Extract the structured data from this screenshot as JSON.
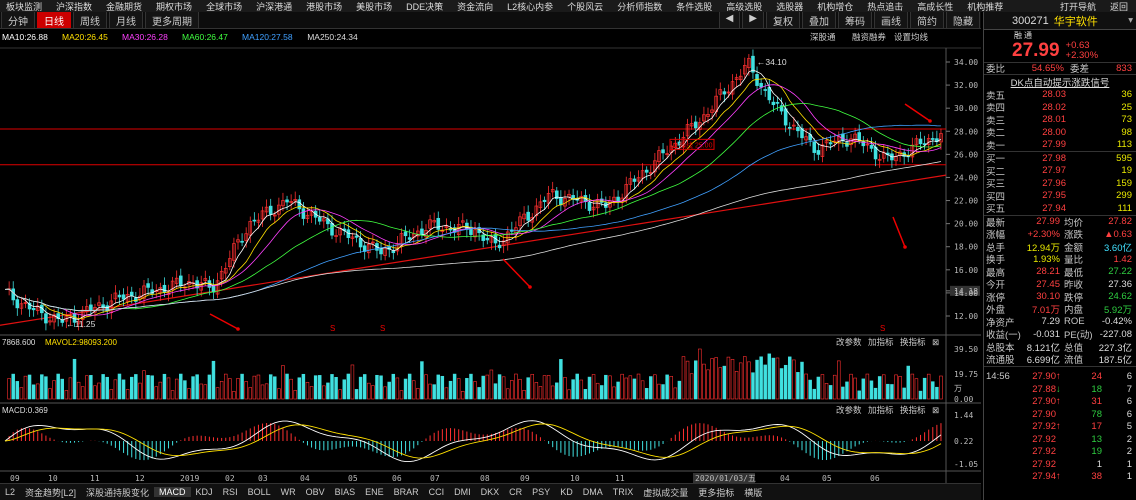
{
  "top_menu": [
    "板块监测",
    "沪深指数",
    "金融期货",
    "期权市场",
    "全球市场",
    "沪深港通",
    "港股市场",
    "美股市场",
    "DDE决策",
    "资金流向",
    "L2核心内参",
    "个股风云",
    "分析师指数",
    "条件选股",
    "高级选股",
    "选股器",
    "机构增仓",
    "热点追击",
    "高成长性",
    "机构推荐"
  ],
  "top_menu_right": [
    "打开导航",
    "返回"
  ],
  "toolbar": {
    "left": [
      "分钟",
      "日线",
      "周线",
      "月线",
      "更多周期"
    ],
    "active": "日线",
    "right": [
      "复权",
      "叠加",
      "筹码",
      "画线",
      "简约",
      "隐藏"
    ],
    "sub": [
      "深股通",
      "融资融券",
      "设置均线"
    ]
  },
  "ma_legend": [
    {
      "label": "MA10:26.88",
      "color": "#ffffff"
    },
    {
      "label": "MA20:26.45",
      "color": "#ffe000"
    },
    {
      "label": "MA30:26.28",
      "color": "#ff40ff"
    },
    {
      "label": "MA60:26.47",
      "color": "#40ff40"
    },
    {
      "label": "MA120:27.58",
      "color": "#40a0ff"
    },
    {
      "label": "MA250:24.34",
      "color": "#dddddd"
    }
  ],
  "price_axis": [
    "34.00",
    "32.00",
    "30.00",
    "28.00",
    "26.00",
    "24.00",
    "22.00",
    "20.00",
    "18.00",
    "16.00",
    "14.18",
    "14.00",
    "12.00"
  ],
  "annotations": {
    "high": "34.10",
    "low": "11.25",
    "box": "止损线 25.00"
  },
  "volume": {
    "legend": "7868.600",
    "mavol": "MAVOL2:98093.200",
    "axis": [
      "39.50",
      "19.75",
      "0.00"
    ],
    "unit": "万",
    "buttons": [
      "改参数",
      "加指标",
      "换指标"
    ]
  },
  "macd": {
    "legend": "MACD:0.369",
    "axis": [
      "1.44",
      "0.22",
      "-1.05"
    ],
    "buttons": [
      "改参数",
      "加指标",
      "换指标"
    ]
  },
  "x_axis": [
    "09",
    "10",
    "11",
    "12",
    "2019",
    "02",
    "03",
    "04",
    "05",
    "06",
    "07",
    "08",
    "09",
    "10",
    "11",
    "2020/01/03/五",
    "04",
    "05",
    "06"
  ],
  "bottom_tabs": [
    "L2",
    "资金趋势[L2]",
    "深股通持股变化",
    "MACD",
    "KDJ",
    "RSI",
    "BOLL",
    "WR",
    "OBV",
    "BIAS",
    "ENE",
    "BRAR",
    "CCI",
    "DMI",
    "DKX",
    "CR",
    "PSY",
    "KD",
    "DMA",
    "TRIX",
    "虚拟成交量",
    "更多指标",
    "横版"
  ],
  "bottom_active": "MACD",
  "stock": {
    "code": "300271",
    "name": "华宇软件",
    "tags": [
      "融",
      "通"
    ],
    "price": "27.99",
    "change": "+0.63",
    "pct": "+2.30%"
  },
  "weibi": {
    "label1": "委比",
    "v1": "54.65%",
    "label2": "委差",
    "v2": "833"
  },
  "signal": "DK点自动提示涨跌信号",
  "asks": [
    {
      "label": "卖五",
      "price": "28.03",
      "vol": "36"
    },
    {
      "label": "卖四",
      "price": "28.02",
      "vol": "25"
    },
    {
      "label": "卖三",
      "price": "28.01",
      "vol": "73"
    },
    {
      "label": "卖二",
      "price": "28.00",
      "vol": "98"
    },
    {
      "label": "卖一",
      "price": "27.99",
      "vol": "113"
    }
  ],
  "bids": [
    {
      "label": "买一",
      "price": "27.98",
      "vol": "595"
    },
    {
      "label": "买二",
      "price": "27.97",
      "vol": "19"
    },
    {
      "label": "买三",
      "price": "27.96",
      "vol": "159"
    },
    {
      "label": "买四",
      "price": "27.95",
      "vol": "299"
    },
    {
      "label": "买五",
      "price": "27.94",
      "vol": "111"
    }
  ],
  "stats": [
    {
      "l1": "最新",
      "v1": "27.99",
      "c1": "red",
      "l2": "均价",
      "v2": "27.82",
      "c2": "red"
    },
    {
      "l1": "涨幅",
      "v1": "+2.30%",
      "c1": "red",
      "l2": "涨跌",
      "v2": "▲0.63",
      "c2": "red"
    },
    {
      "l1": "总手",
      "v1": "12.94万",
      "c1": "yel",
      "l2": "金额",
      "v2": "3.60亿",
      "c2": "cyan"
    },
    {
      "l1": "换手",
      "v1": "1.93%",
      "c1": "yel",
      "l2": "量比",
      "v2": "1.42",
      "c2": "red"
    },
    {
      "l1": "最高",
      "v1": "28.21",
      "c1": "red",
      "l2": "最低",
      "v2": "27.22",
      "c2": "grn"
    },
    {
      "l1": "今开",
      "v1": "27.45",
      "c1": "red",
      "l2": "昨收",
      "v2": "27.36",
      "c2": "wht"
    },
    {
      "l1": "涨停",
      "v1": "30.10",
      "c1": "red",
      "l2": "跌停",
      "v2": "24.62",
      "c2": "grn"
    },
    {
      "l1": "外盘",
      "v1": "7.01万",
      "c1": "red",
      "l2": "内盘",
      "v2": "5.92万",
      "c2": "grn"
    },
    {
      "l1": "净资产",
      "v1": "7.29",
      "c1": "wht",
      "l2": "ROE",
      "v2": "-0.42%",
      "c2": "wht"
    },
    {
      "l1": "收益(一)",
      "v1": "-0.031",
      "c1": "wht",
      "l2": "PE(动)",
      "v2": "-227.08",
      "c2": "wht"
    },
    {
      "l1": "总股本",
      "v1": "8.121亿",
      "c1": "wht",
      "l2": "总值",
      "v2": "227.3亿",
      "c2": "wht"
    },
    {
      "l1": "流通股",
      "v1": "6.699亿",
      "c1": "wht",
      "l2": "流值",
      "v2": "187.5亿",
      "c2": "wht"
    }
  ],
  "ticks": [
    {
      "t": "14:56",
      "p": "27.90",
      "arrow": "↑",
      "pc": "red",
      "v": "24",
      "vc": "red",
      "n": "6"
    },
    {
      "t": "",
      "p": "27.88",
      "arrow": "↓",
      "pc": "red",
      "v": "18",
      "vc": "grn",
      "n": "7"
    },
    {
      "t": "",
      "p": "27.90",
      "arrow": "↑",
      "pc": "red",
      "v": "31",
      "vc": "red",
      "n": "6"
    },
    {
      "t": "",
      "p": "27.90",
      "arrow": "",
      "pc": "red",
      "v": "78",
      "vc": "grn",
      "n": "6"
    },
    {
      "t": "",
      "p": "27.92",
      "arrow": "↑",
      "pc": "red",
      "v": "17",
      "vc": "red",
      "n": "5"
    },
    {
      "t": "",
      "p": "27.92",
      "arrow": "",
      "pc": "red",
      "v": "13",
      "vc": "grn",
      "n": "2"
    },
    {
      "t": "",
      "p": "27.92",
      "arrow": "",
      "pc": "red",
      "v": "19",
      "vc": "grn",
      "n": "2"
    },
    {
      "t": "",
      "p": "27.92",
      "arrow": "",
      "pc": "red",
      "v": "1",
      "vc": "wht",
      "n": "1"
    },
    {
      "t": "",
      "p": "27.94",
      "arrow": "↑",
      "pc": "red",
      "v": "38",
      "vc": "red",
      "n": "1"
    }
  ]
}
